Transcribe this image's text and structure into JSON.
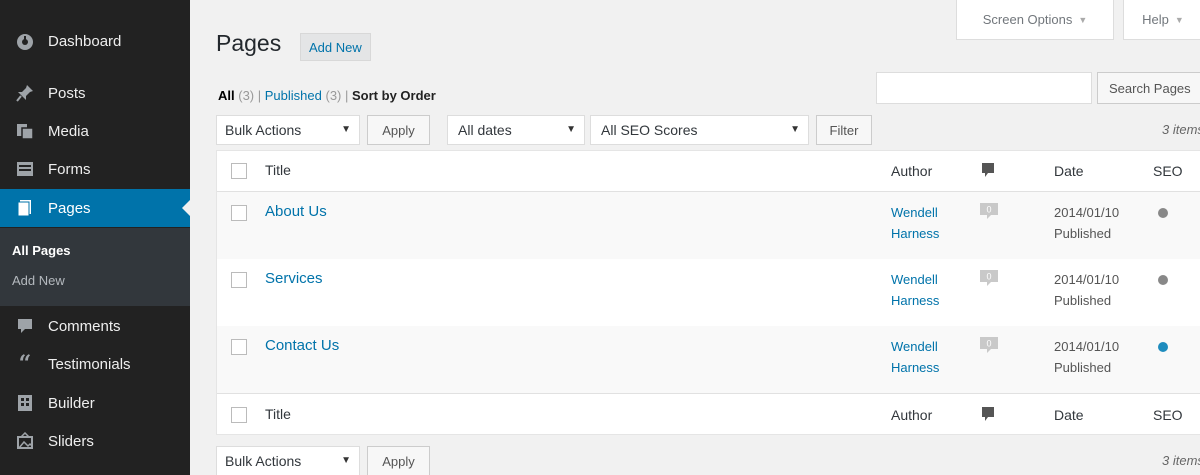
{
  "sidebar": {
    "items": [
      {
        "label": "Dashboard",
        "icon": "dashboard-icon"
      },
      {
        "label": "Posts",
        "icon": "pin-icon"
      },
      {
        "label": "Media",
        "icon": "media-icon"
      },
      {
        "label": "Forms",
        "icon": "forms-icon"
      },
      {
        "label": "Pages",
        "icon": "pages-icon"
      },
      {
        "label": "Comments",
        "icon": "comments-icon"
      },
      {
        "label": "Testimonials",
        "icon": "quote-icon"
      },
      {
        "label": "Builder",
        "icon": "builder-icon"
      },
      {
        "label": "Sliders",
        "icon": "sliders-icon"
      }
    ],
    "submenu": [
      "All Pages",
      "Add New"
    ]
  },
  "top": {
    "screen_options": "Screen Options",
    "help": "Help"
  },
  "header": {
    "title": "Pages",
    "add_new": "Add New"
  },
  "filters": {
    "all": "All",
    "all_count": "(3)",
    "published": "Published",
    "published_count": "(3)",
    "sort": "Sort by Order"
  },
  "search": {
    "button": "Search Pages",
    "placeholder": ""
  },
  "controls": {
    "bulk_actions": "Bulk Actions",
    "apply": "Apply",
    "dates": "All dates",
    "seo_scores": "All SEO Scores",
    "filter": "Filter",
    "items": "3 items"
  },
  "table": {
    "headers": {
      "title": "Title",
      "author": "Author",
      "date": "Date",
      "seo": "SEO"
    },
    "rows": [
      {
        "title": "About Us",
        "author1": "Wendell",
        "author2": "Harness",
        "comments": "0",
        "date": "2014/01/10",
        "status": "Published",
        "seo_color": "#888888"
      },
      {
        "title": "Services",
        "author1": "Wendell",
        "author2": "Harness",
        "comments": "0",
        "date": "2014/01/10",
        "status": "Published",
        "seo_color": "#888888"
      },
      {
        "title": "Contact Us",
        "author1": "Wendell",
        "author2": "Harness",
        "comments": "0",
        "date": "2014/01/10",
        "status": "Published",
        "seo_color": "#1e8cbe"
      }
    ]
  }
}
